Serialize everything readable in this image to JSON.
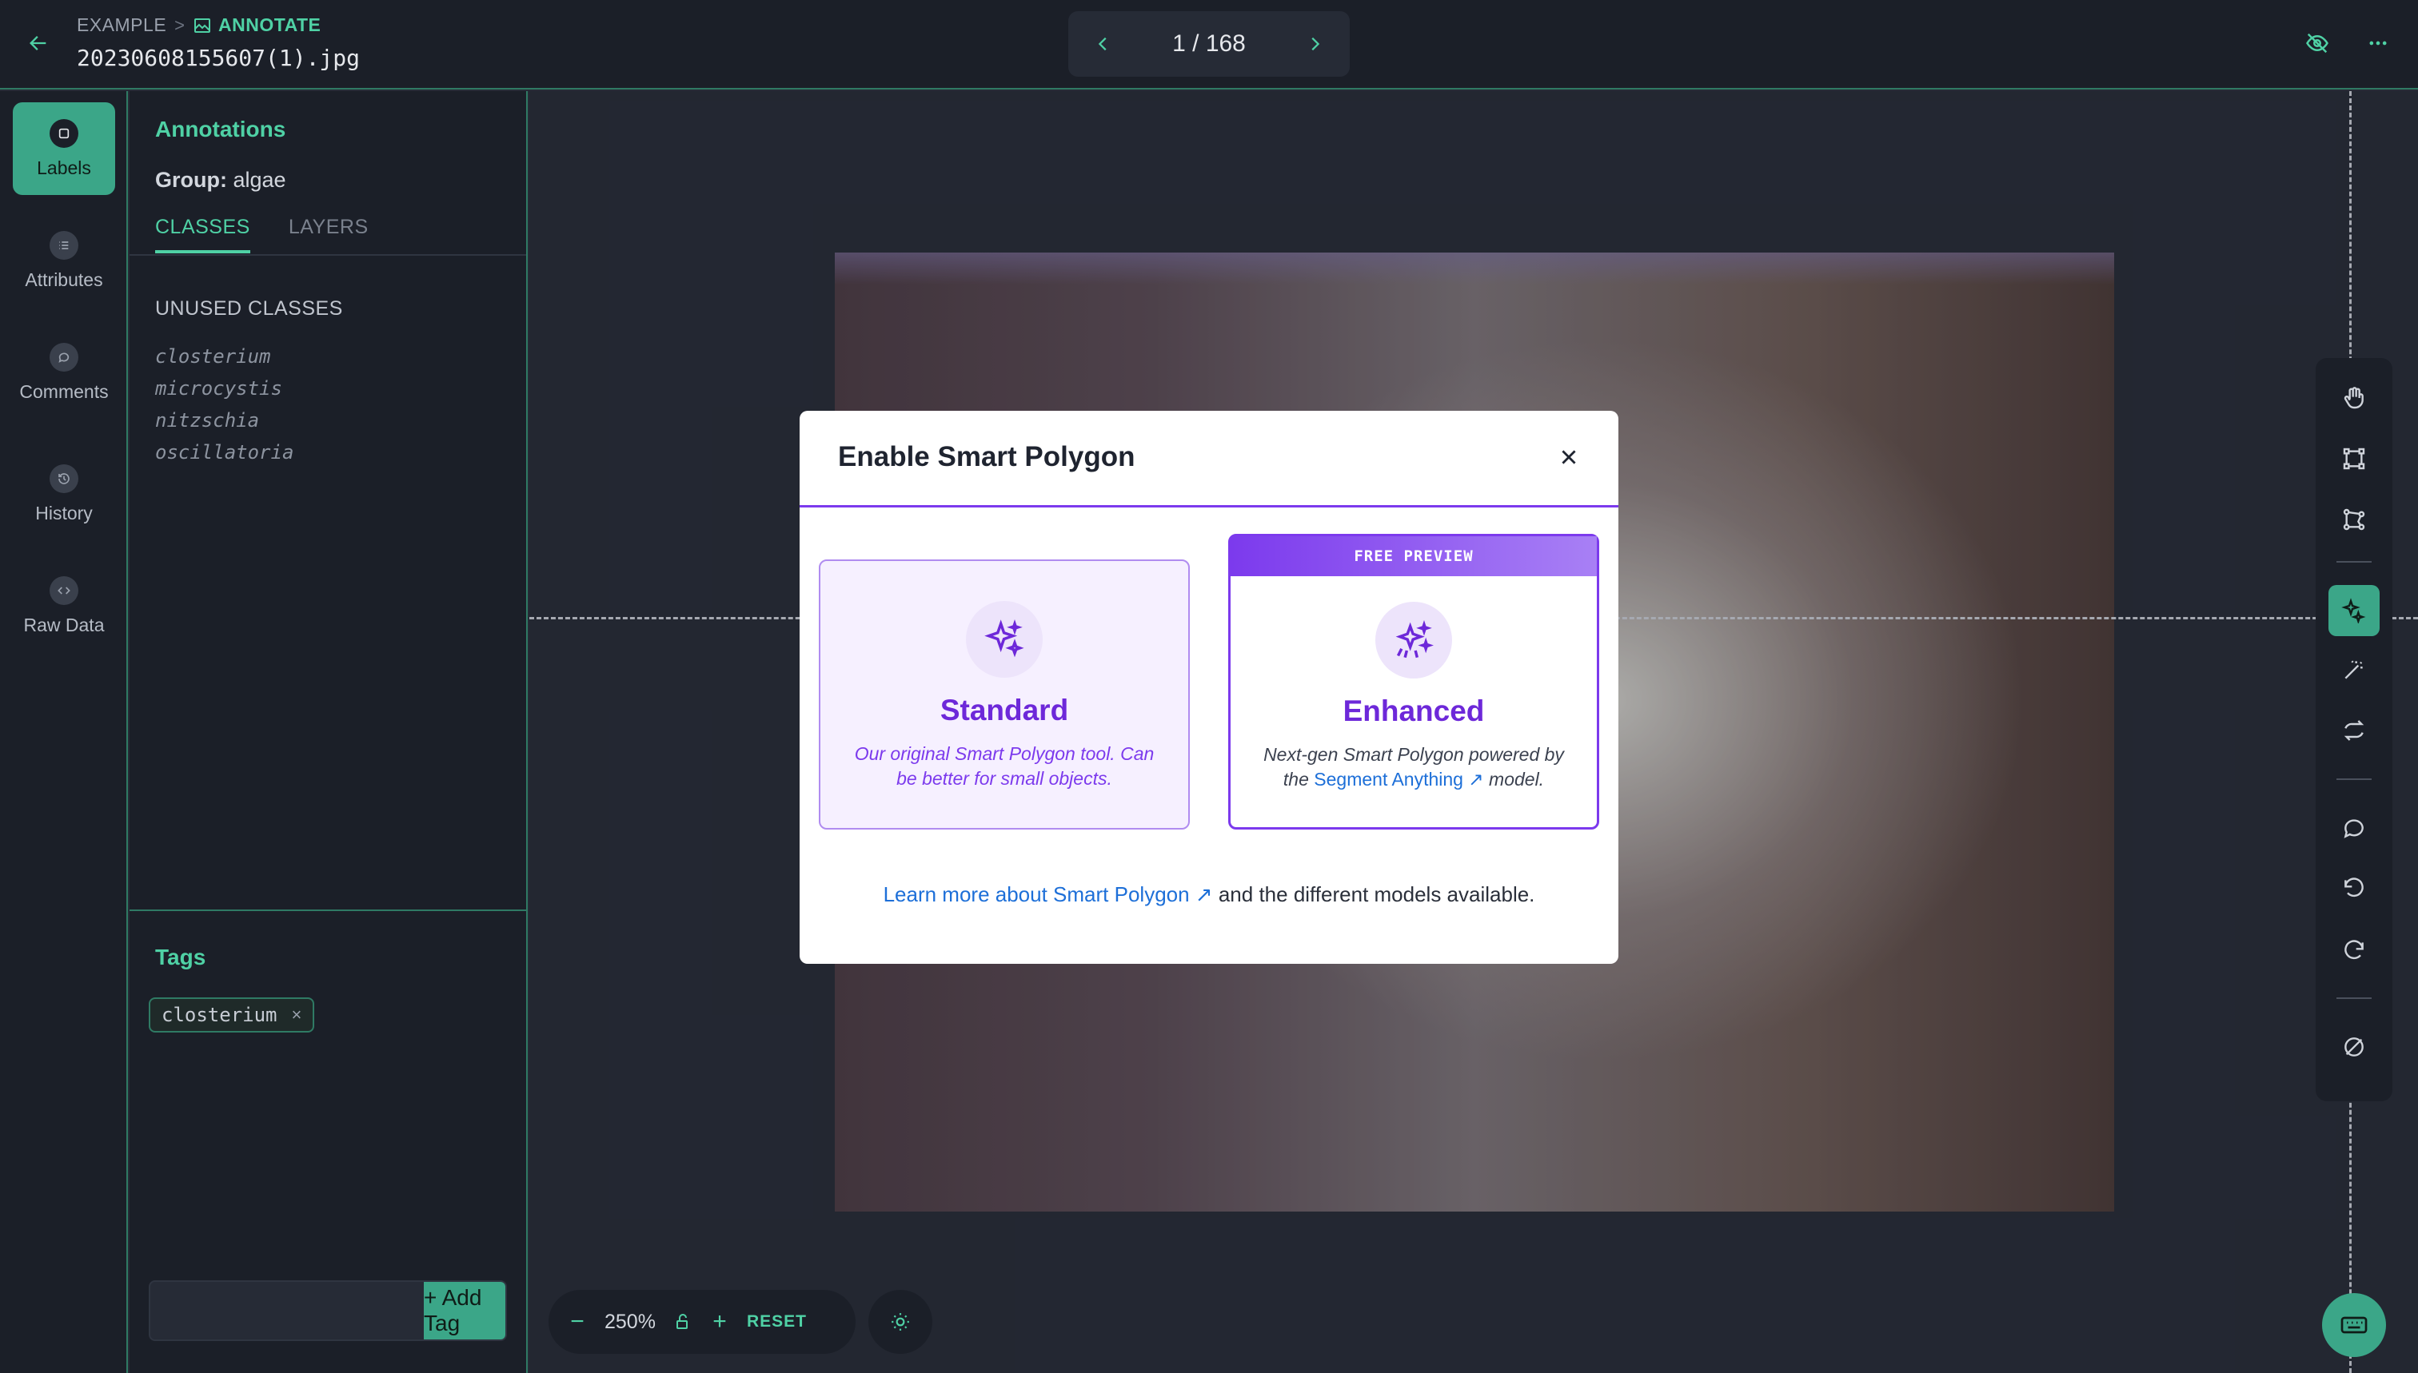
{
  "header": {
    "breadcrumb_project": "EXAMPLE",
    "breadcrumb_separator": ">",
    "breadcrumb_section": "ANNOTATE",
    "file_name": "20230608155607(1).jpg",
    "pager_text": "1 / 168"
  },
  "rail": {
    "items": [
      {
        "label": "Labels",
        "icon": "tag-icon",
        "active": true
      },
      {
        "label": "Attributes",
        "icon": "list-icon"
      },
      {
        "label": "Comments",
        "icon": "comment-icon"
      },
      {
        "label": "History",
        "icon": "history-icon"
      },
      {
        "label": "Raw Data",
        "icon": "code-icon"
      }
    ]
  },
  "panel": {
    "title": "Annotations",
    "group_label": "Group:",
    "group_value": "algae",
    "tabs": [
      {
        "label": "CLASSES",
        "active": true
      },
      {
        "label": "LAYERS"
      }
    ],
    "unused_title": "UNUSED CLASSES",
    "classes": [
      "closterium",
      "microcystis",
      "nitzschia",
      "oscillatoria"
    ],
    "tags_title": "Tags",
    "tags": [
      "closterium"
    ],
    "tag_remove": "×",
    "tag_input_value": "",
    "add_tag_label": "+ Add Tag"
  },
  "zoom": {
    "minus": "−",
    "value": "250%",
    "plus": "+",
    "reset": "RESET"
  },
  "modal": {
    "title": "Enable Smart Polygon",
    "close": "×",
    "standard": {
      "name": "Standard",
      "description": "Our original Smart Polygon tool. Can be better for small objects."
    },
    "enhanced": {
      "badge": "FREE PREVIEW",
      "name": "Enhanced",
      "description_before": "Next-gen Smart Polygon powered by the",
      "link": "Segment Anything",
      "description_after": "model."
    },
    "footer_link": "Learn more about Smart Polygon",
    "footer_rest": "and the different models available."
  },
  "colors": {
    "accent_green": "#3ba688",
    "accent_purple": "#7c3aed",
    "link_blue": "#1d6fd8",
    "background": "#262b36"
  }
}
